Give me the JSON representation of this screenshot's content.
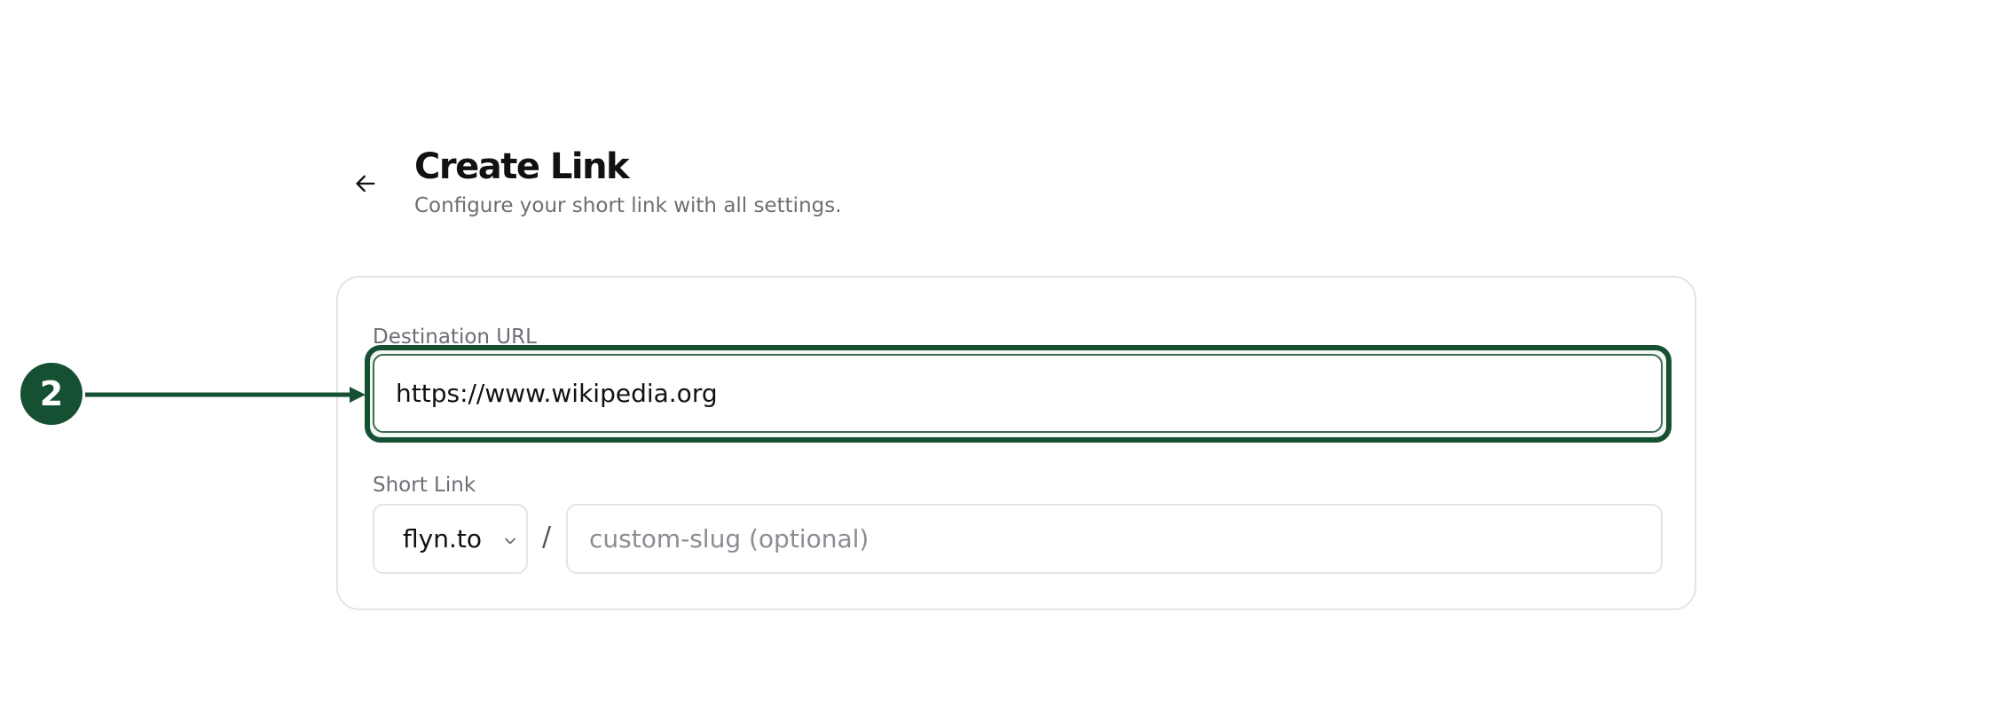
{
  "header": {
    "back_icon": "arrow-left-icon",
    "title": "Create Link",
    "subtitle": "Configure your short link with all settings."
  },
  "form": {
    "destination": {
      "label": "Destination URL",
      "value": "https://www.wikipedia.org"
    },
    "short_link": {
      "label": "Short Link",
      "domain": "flyn.to",
      "separator": "/",
      "slug_placeholder": "custom-slug (optional)",
      "slug_value": ""
    }
  },
  "annotation": {
    "step_number": "2",
    "color": "#165033"
  },
  "colors": {
    "accent": "#165033",
    "border": "#e4e4e7",
    "muted_text": "#6e6e6e"
  }
}
